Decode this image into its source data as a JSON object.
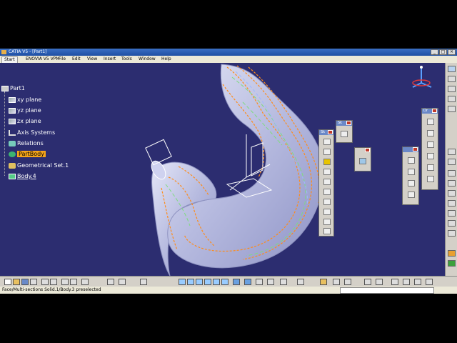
{
  "window": {
    "title": "CATIA V5 - [Part1]"
  },
  "menu": {
    "start": "Start",
    "items": [
      "ENOVIA V5 VPM",
      "File",
      "Edit",
      "View",
      "Insert",
      "Tools",
      "Window",
      "Help"
    ]
  },
  "tree": {
    "root": "Part1",
    "items": [
      {
        "label": "xy plane",
        "icon": "plane-icon"
      },
      {
        "label": "yz plane",
        "icon": "plane-icon"
      },
      {
        "label": "zx plane",
        "icon": "plane-icon"
      },
      {
        "label": "Axis Systems",
        "icon": "axis-icon"
      },
      {
        "label": "Relations",
        "icon": "relations-icon"
      },
      {
        "label": "PartBody",
        "icon": "gear-icon",
        "selected": true
      },
      {
        "label": "Geometrical Set.1",
        "icon": "geometrical-set-icon"
      },
      {
        "label": "Body.4",
        "icon": "body-icon",
        "underlined": true
      }
    ]
  },
  "toolbars": [
    {
      "header": "Sk"
    },
    {
      "header": "Sk"
    },
    {
      "header": "Dr"
    },
    {
      "header": "Dr"
    }
  ],
  "status": {
    "text": "Face/Multi-sections Solid.1/Body.3 preselected"
  },
  "colors": {
    "background": "#2c2d70",
    "selection": "#f6a51a",
    "surface": "#b9bde3",
    "edge_orange": "#ff8c1a",
    "edge_green": "#7fdc7f"
  }
}
